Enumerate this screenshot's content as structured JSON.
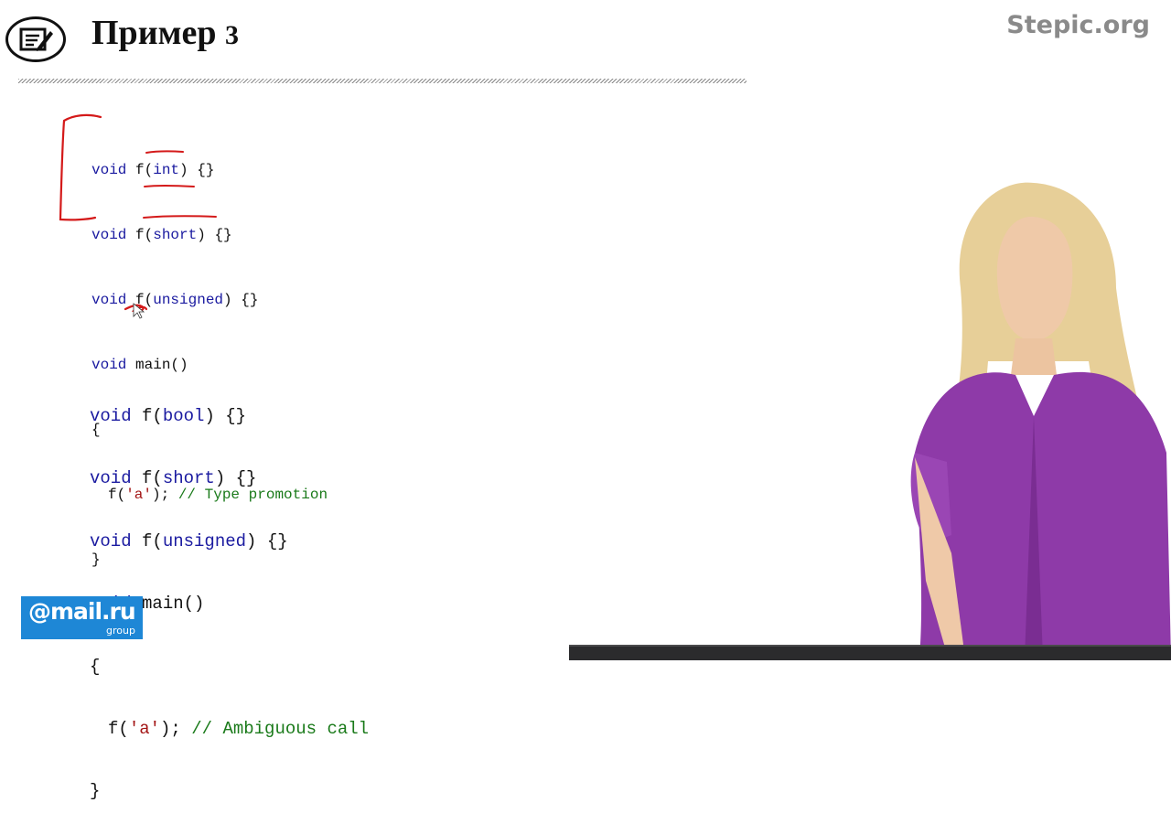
{
  "header": {
    "title": "Пример",
    "title_number": "3",
    "brand": "Stepic.org",
    "icon": "edit-note-icon"
  },
  "code_block_1": {
    "lines": [
      {
        "kw": "void",
        "pre": " f(",
        "arg": "int",
        "post": ") {}"
      },
      {
        "kw": "void",
        "pre": " f(",
        "arg": "short",
        "post": ") {}"
      },
      {
        "kw": "void",
        "pre": " f(",
        "arg": "unsigned",
        "post": ") {}"
      },
      {
        "kw": "void",
        "pre": " main()"
      },
      {
        "text": "{"
      },
      {
        "call_pre": "f(",
        "str": "'a'",
        "call_post": ");",
        "comment": " // Type promotion"
      },
      {
        "text": "}"
      }
    ]
  },
  "code_block_2": {
    "lines": [
      {
        "kw": "void",
        "pre": " f(",
        "arg": "bool",
        "post": ") {}"
      },
      {
        "kw": "void",
        "pre": " f(",
        "arg": "short",
        "post": ") {}"
      },
      {
        "kw": "void",
        "pre": " f(",
        "arg": "unsigned",
        "post": ") {}"
      },
      {
        "kw": "void",
        "pre": " main()"
      },
      {
        "text": "{"
      },
      {
        "call_pre": "f(",
        "str": "'a'",
        "call_post": ");",
        "comment": " // Ambiguous call"
      },
      {
        "text": "}"
      }
    ]
  },
  "logo": {
    "main": "@mail.ru",
    "sub": "group"
  },
  "colors": {
    "keyword": "#1a1aa0",
    "string": "#a31515",
    "comment": "#1a7a1a",
    "annotation": "#d41a1a",
    "logo_bg": "#1e87d6",
    "brand_gray": "#8a8a8a"
  }
}
